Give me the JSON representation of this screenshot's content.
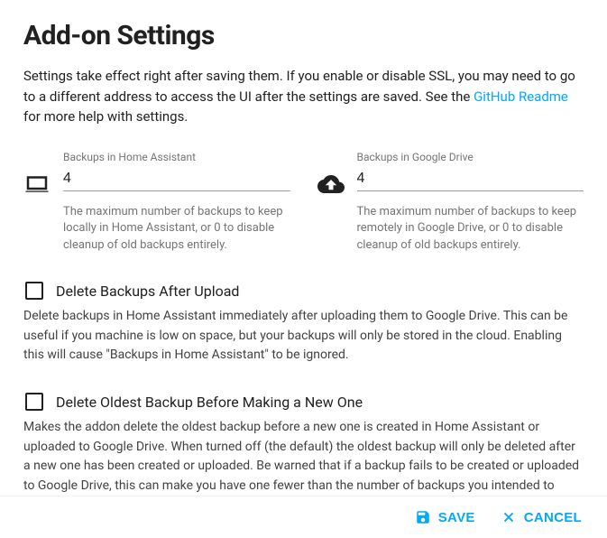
{
  "title": "Add-on Settings",
  "intro": {
    "part1": "Settings take effect right after saving them. If you enable or disable SSL, you may need to go to a different address to access the UI after the settings are saved. See the ",
    "link_text": "GitHub Readme",
    "part2": " for more help with settings."
  },
  "fields": {
    "ha": {
      "label": "Backups in Home Assistant",
      "value": "4",
      "help": "The maximum number of backups to keep locally in Home Assistant, or 0 to disable cleanup of old backups entirely."
    },
    "drive": {
      "label": "Backups in Google Drive",
      "value": "4",
      "help": "The maximum number of backups to keep remotely in Google Drive, or 0 to disable cleanup of old backups entirely."
    }
  },
  "checkboxes": {
    "delete_after_upload": {
      "label": "Delete Backups After Upload",
      "desc": "Delete backups in Home Assistant immediately after uploading them to Google Drive. This can be useful if you machine is low on space, but your backups will only be stored in the cloud. Enabling this will cause \"Backups in Home Assistant\" to be ignored."
    },
    "delete_oldest_before_new": {
      "label": "Delete Oldest Backup Before Making a New One",
      "desc": "Makes the addon delete the oldest backup before a new one is created in Home Assistant or uploaded to Google Drive. When turned off (the default) the oldest backup will only be deleted after a new one has been created or uploaded. Be warned that if a backup fails to be created or uploaded to Google Drive, this can make you have one fewer than the number of backups you intended to keep there."
    }
  },
  "actions": {
    "save": "SAVE",
    "cancel": "CANCEL"
  }
}
